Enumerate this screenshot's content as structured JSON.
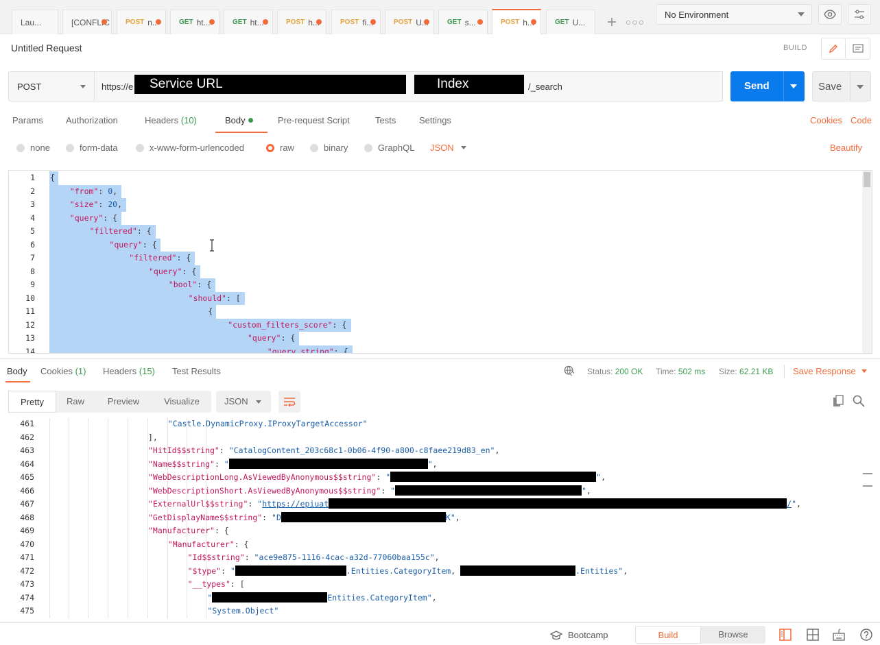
{
  "tabs": [
    {
      "method": "",
      "name": "Lau...",
      "dot": false
    },
    {
      "method": "",
      "name": "[CONFLIC",
      "dot": true
    },
    {
      "method": "POST",
      "name": "n..",
      "dot": true
    },
    {
      "method": "GET",
      "name": "ht...",
      "dot": true
    },
    {
      "method": "GET",
      "name": "ht...",
      "dot": true
    },
    {
      "method": "POST",
      "name": "h...",
      "dot": true
    },
    {
      "method": "POST",
      "name": "fi...",
      "dot": true
    },
    {
      "method": "POST",
      "name": "U...",
      "dot": true
    },
    {
      "method": "GET",
      "name": "s...",
      "dot": true
    },
    {
      "method": "POST",
      "name": "h...",
      "dot": true,
      "active": true
    },
    {
      "method": "GET",
      "name": "U...",
      "dot": false
    }
  ],
  "environment": {
    "selected": "No Environment"
  },
  "request": {
    "title": "Untitled Request",
    "build_label": "BUILD",
    "method": "POST",
    "url_prefix": "https://e",
    "redact_service": "Service URL",
    "redact_index": "Index",
    "url_suffix": "/_search",
    "send_label": "Send",
    "save_label": "Save"
  },
  "request_tabs": {
    "params": "Params",
    "authorization": "Authorization",
    "headers": "Headers",
    "headers_count": "(10)",
    "body": "Body",
    "prerequest": "Pre-request Script",
    "tests": "Tests",
    "settings": "Settings",
    "cookies": "Cookies",
    "code": "Code"
  },
  "body_types": {
    "none": "none",
    "form_data": "form-data",
    "urlencoded": "x-www-form-urlencoded",
    "raw": "raw",
    "binary": "binary",
    "graphql": "GraphQL",
    "format": "JSON",
    "beautify": "Beautify"
  },
  "request_body_lines": [
    {
      "n": "1",
      "indent": 0,
      "text": "{"
    },
    {
      "n": "2",
      "indent": 1,
      "key": "\"from\"",
      "rest": ": ",
      "val": "0",
      "tail": ","
    },
    {
      "n": "3",
      "indent": 1,
      "key": "\"size\"",
      "rest": ": ",
      "val": "20",
      "tail": ","
    },
    {
      "n": "4",
      "indent": 1,
      "key": "\"query\"",
      "rest": ": {"
    },
    {
      "n": "5",
      "indent": 2,
      "key": "\"filtered\"",
      "rest": ": {"
    },
    {
      "n": "6",
      "indent": 3,
      "key": "\"query\"",
      "rest": ": {"
    },
    {
      "n": "7",
      "indent": 4,
      "key": "\"filtered\"",
      "rest": ": {"
    },
    {
      "n": "8",
      "indent": 5,
      "key": "\"query\"",
      "rest": ": {"
    },
    {
      "n": "9",
      "indent": 6,
      "key": "\"bool\"",
      "rest": ": {"
    },
    {
      "n": "10",
      "indent": 7,
      "key": "\"should\"",
      "rest": ": ["
    },
    {
      "n": "11",
      "indent": 8,
      "text": "{"
    },
    {
      "n": "12",
      "indent": 9,
      "key": "\"custom_filters_score\"",
      "rest": ": {"
    },
    {
      "n": "13",
      "indent": 10,
      "key": "\"query\"",
      "rest": ": {"
    },
    {
      "n": "14",
      "indent": 11,
      "key": "\"query_string\"",
      "rest": ": {"
    }
  ],
  "response_tabs": {
    "body": "Body",
    "cookies": "Cookies",
    "cookies_count": "(1)",
    "headers": "Headers",
    "headers_count": "(15)",
    "test_results": "Test Results"
  },
  "response_status": {
    "status_label": "Status:",
    "status_value": "200 OK",
    "time_label": "Time:",
    "time_value": "502 ms",
    "size_label": "Size:",
    "size_value": "62.21 KB",
    "save_response": "Save Response"
  },
  "view_modes": {
    "pretty": "Pretty",
    "raw": "Raw",
    "preview": "Preview",
    "visualize": "Visualize",
    "format": "JSON"
  },
  "response_lines": [
    {
      "n": "461",
      "indent": 6,
      "parts": [
        {
          "t": "s",
          "v": "\"Castle.DynamicProxy.IProxyTargetAccessor\""
        }
      ]
    },
    {
      "n": "462",
      "indent": 5,
      "parts": [
        {
          "t": "p",
          "v": "],"
        }
      ]
    },
    {
      "n": "463",
      "indent": 5,
      "parts": [
        {
          "t": "k",
          "v": "\"HitId$$string\""
        },
        {
          "t": "p",
          "v": ": "
        },
        {
          "t": "s",
          "v": "\"CatalogContent_203c68c1-0b06-4f90-a800-c8faee219d83_en\""
        },
        {
          "t": "p",
          "v": ","
        }
      ]
    },
    {
      "n": "464",
      "indent": 5,
      "parts": [
        {
          "t": "k",
          "v": "\"Name$$string\""
        },
        {
          "t": "p",
          "v": ": "
        },
        {
          "t": "s",
          "v": "\""
        },
        {
          "t": "r",
          "w": 290
        },
        {
          "t": "s",
          "v": "\""
        },
        {
          "t": "p",
          "v": ","
        }
      ]
    },
    {
      "n": "465",
      "indent": 5,
      "parts": [
        {
          "t": "k",
          "v": "\"WebDescriptionLong.AsViewedByAnonymous$$string\""
        },
        {
          "t": "p",
          "v": ": "
        },
        {
          "t": "s",
          "v": "\""
        },
        {
          "t": "r",
          "w": 300
        },
        {
          "t": "s",
          "v": "\""
        },
        {
          "t": "p",
          "v": ","
        }
      ]
    },
    {
      "n": "466",
      "indent": 5,
      "parts": [
        {
          "t": "k",
          "v": "\"WebDescriptionShort.AsViewedByAnonymous$$string\""
        },
        {
          "t": "p",
          "v": ": "
        },
        {
          "t": "s",
          "v": "\""
        },
        {
          "t": "r",
          "w": 272
        },
        {
          "t": "s",
          "v": "\""
        },
        {
          "t": "p",
          "v": ","
        }
      ]
    },
    {
      "n": "467",
      "indent": 5,
      "parts": [
        {
          "t": "k",
          "v": "\"ExternalUrl$$string\""
        },
        {
          "t": "p",
          "v": ": "
        },
        {
          "t": "s",
          "v": "\""
        },
        {
          "t": "u",
          "v": "https://epiuat"
        },
        {
          "t": "r",
          "w": 668
        },
        {
          "t": "u",
          "v": "/"
        },
        {
          "t": "s",
          "v": "\""
        },
        {
          "t": "p",
          "v": ","
        }
      ]
    },
    {
      "n": "468",
      "indent": 5,
      "parts": [
        {
          "t": "k",
          "v": "\"GetDisplayName$$string\""
        },
        {
          "t": "p",
          "v": ": "
        },
        {
          "t": "s",
          "v": "\"D"
        },
        {
          "t": "r",
          "w": 240
        },
        {
          "t": "s",
          "v": "K\""
        },
        {
          "t": "p",
          "v": ","
        }
      ]
    },
    {
      "n": "469",
      "indent": 5,
      "parts": [
        {
          "t": "k",
          "v": "\"Manufacturer\""
        },
        {
          "t": "p",
          "v": ": {"
        }
      ]
    },
    {
      "n": "470",
      "indent": 6,
      "parts": [
        {
          "t": "k",
          "v": "\"Manufacturer\""
        },
        {
          "t": "p",
          "v": ": {"
        }
      ]
    },
    {
      "n": "471",
      "indent": 7,
      "parts": [
        {
          "t": "k",
          "v": "\"Id$$string\""
        },
        {
          "t": "p",
          "v": ": "
        },
        {
          "t": "s",
          "v": "\"ace9e875-1116-4cac-a32d-77060baa155c\""
        },
        {
          "t": "p",
          "v": ","
        }
      ]
    },
    {
      "n": "472",
      "indent": 7,
      "parts": [
        {
          "t": "k",
          "v": "\"$type\""
        },
        {
          "t": "p",
          "v": ": "
        },
        {
          "t": "s",
          "v": "\""
        },
        {
          "t": "r",
          "w": 162
        },
        {
          "t": "s",
          "v": ".Entities.CategoryItem"
        },
        {
          "t": "p",
          "v": ", "
        },
        {
          "t": "r",
          "w": 168
        },
        {
          "t": "s",
          "v": ".Entities\""
        },
        {
          "t": "p",
          "v": ","
        }
      ]
    },
    {
      "n": "473",
      "indent": 7,
      "parts": [
        {
          "t": "k",
          "v": "\"__types\""
        },
        {
          "t": "p",
          "v": ": ["
        }
      ]
    },
    {
      "n": "474",
      "indent": 8,
      "parts": [
        {
          "t": "s",
          "v": "\""
        },
        {
          "t": "r",
          "w": 168
        },
        {
          "t": "s",
          "v": "Entities.CategoryItem\""
        },
        {
          "t": "p",
          "v": ","
        }
      ]
    },
    {
      "n": "475",
      "indent": 8,
      "parts": [
        {
          "t": "s",
          "v": "\"System.Object\""
        }
      ]
    }
  ],
  "statusbar": {
    "bootcamp": "Bootcamp",
    "build": "Build",
    "browse": "Browse"
  },
  "colors": {
    "accent": "#f26b3a",
    "send": "#097bed",
    "success": "#3b9a4f",
    "selection": "#b5d5f7"
  }
}
